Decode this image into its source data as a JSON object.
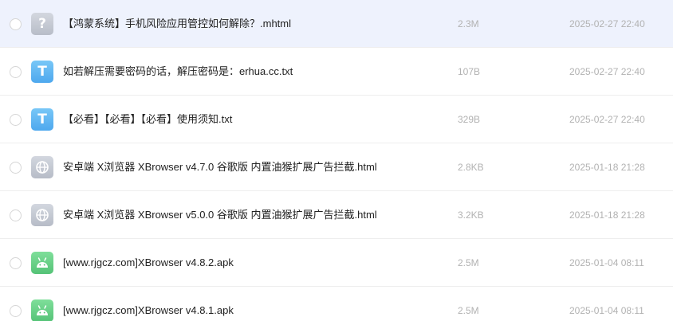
{
  "files": [
    {
      "name": "【鸿蒙系统】手机风险应用管控如何解除？.mhtml",
      "size": "2.3M",
      "date": "2025-02-27 22:40",
      "icon": "question-icon",
      "selected": true
    },
    {
      "name": "如若解压需要密码的话，解压密码是：erhua.cc.txt",
      "size": "107B",
      "date": "2025-02-27 22:40",
      "icon": "text-file-icon",
      "selected": false
    },
    {
      "name": "【必看】【必看】【必看】使用须知.txt",
      "size": "329B",
      "date": "2025-02-27 22:40",
      "icon": "text-file-icon",
      "selected": false
    },
    {
      "name": "安卓端 X浏览器 XBrowser v4.7.0 谷歌版 内置油猴扩展广告拦截.html",
      "size": "2.8KB",
      "date": "2025-01-18 21:28",
      "icon": "globe-icon",
      "selected": false
    },
    {
      "name": "安卓端 X浏览器 XBrowser v5.0.0 谷歌版 内置油猴扩展广告拦截.html",
      "size": "3.2KB",
      "date": "2025-01-18 21:28",
      "icon": "globe-icon",
      "selected": false
    },
    {
      "name": "[www.rjgcz.com]XBrowser v4.8.2.apk",
      "size": "2.5M",
      "date": "2025-01-04 08:11",
      "icon": "android-icon",
      "selected": false
    },
    {
      "name": "[www.rjgcz.com]XBrowser v4.8.1.apk",
      "size": "2.5M",
      "date": "2025-01-04 08:11",
      "icon": "android-icon",
      "selected": false
    }
  ],
  "icon_glyphs": {
    "question": "?",
    "text": "T"
  },
  "colors": {
    "selected_row": "#eef2fd",
    "text_icon": "#4ea8ee",
    "android_icon": "#55c377",
    "muted_text": "#b2b2b2"
  }
}
